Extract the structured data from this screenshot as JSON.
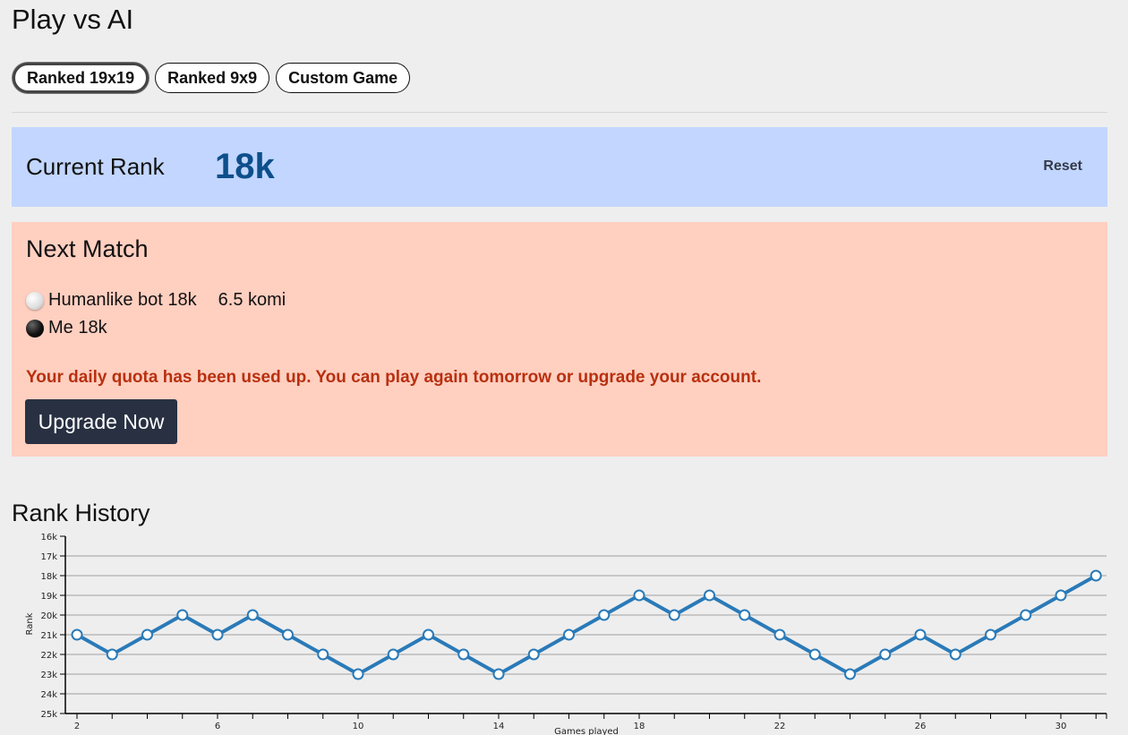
{
  "page_title": "Play vs AI",
  "tabs": [
    {
      "label": "Ranked 19x19",
      "active": true
    },
    {
      "label": "Ranked 9x9",
      "active": false
    },
    {
      "label": "Custom Game",
      "active": false
    }
  ],
  "current_rank": {
    "label": "Current Rank",
    "value": "18k",
    "reset_label": "Reset"
  },
  "next_match": {
    "title": "Next Match",
    "opponent": {
      "stone": "white",
      "name": "Humanlike bot 18k",
      "komi": "6.5 komi"
    },
    "me": {
      "stone": "black",
      "name": "Me 18k"
    },
    "quota_message": "Your daily quota has been used up. You can play again tomorrow or upgrade your account.",
    "upgrade_label": "Upgrade Now"
  },
  "rank_history_title": "Rank History",
  "colors": {
    "line": "#2a7ab8",
    "rank_banner": "#c2d6ff",
    "match_panel": "#ffcfc0",
    "quota_text": "#b8300f"
  },
  "chart_data": {
    "type": "line",
    "xlabel": "Games played",
    "ylabel": "Rank",
    "x": [
      2,
      3,
      4,
      5,
      6,
      7,
      8,
      9,
      10,
      11,
      12,
      13,
      14,
      15,
      16,
      17,
      18,
      19,
      20,
      21,
      22,
      23,
      24,
      25,
      26,
      27,
      28,
      29,
      30,
      31
    ],
    "values_kyu": [
      21,
      22,
      21,
      20,
      21,
      20,
      21,
      22,
      23,
      22,
      21,
      22,
      23,
      22,
      21,
      20,
      19,
      20,
      19,
      20,
      21,
      22,
      23,
      22,
      21,
      22,
      21,
      20,
      19,
      18
    ],
    "x_ticks": [
      2,
      6,
      10,
      14,
      18,
      22,
      26,
      30
    ],
    "y_tick_labels": [
      "16k",
      "17k",
      "18k",
      "19k",
      "20k",
      "21k",
      "22k",
      "23k",
      "24k",
      "25k"
    ],
    "ylim_kyu": [
      25,
      16
    ],
    "grid": true
  }
}
